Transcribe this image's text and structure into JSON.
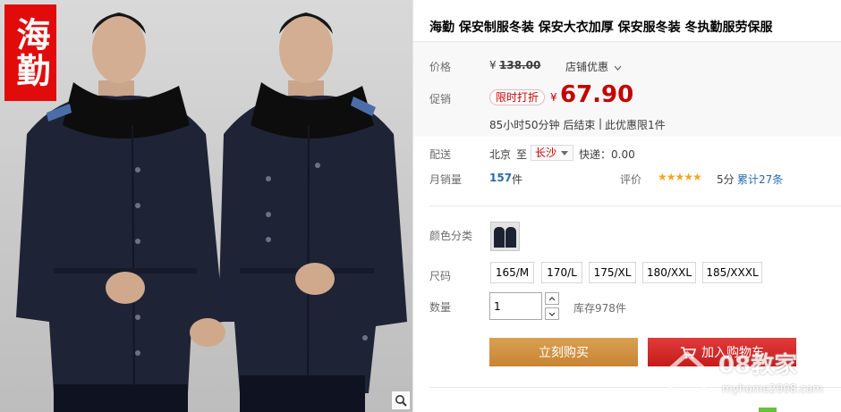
{
  "product": {
    "brand_badge": "海勤",
    "title": "海勤 保安制服冬装 保安大衣加厚 保安服冬装 冬执勤服劳保服"
  },
  "price": {
    "label": "价格",
    "currency": "¥",
    "original": "138.00",
    "shop_promo": "店铺优惠"
  },
  "promo": {
    "label": "促销",
    "tag": "限时打折",
    "currency": "¥",
    "price": "67.90",
    "countdown": "85小时50分钟 后结束",
    "limit": "此优惠限1件"
  },
  "shipping": {
    "label": "配送",
    "from": "北京",
    "to_word": "至",
    "to": "长沙",
    "fee": "快递：0.00"
  },
  "sales": {
    "label": "月销量",
    "count": "157",
    "unit": "件"
  },
  "rating": {
    "label": "评价",
    "stars": "★★★★★",
    "score": "5分",
    "total": "累计27条"
  },
  "options": {
    "color_label": "颜色分类",
    "size_label": "尺码",
    "sizes": [
      "165/M",
      "170/L",
      "175/XL",
      "180/XXL",
      "185/XXXL"
    ],
    "qty_label": "数量",
    "qty_value": "1",
    "stock": "库存978件"
  },
  "actions": {
    "buy_now": "立刻购买",
    "add_cart": "加入购物车"
  },
  "watermark": {
    "text": "08教家",
    "url": "myhome2008.com"
  },
  "colors": {
    "accent_red": "#c40000",
    "buy_button": "#c88433",
    "cart_button": "#c51b1b",
    "badge_red": "#e20b0b",
    "stars": "#f5a623"
  }
}
